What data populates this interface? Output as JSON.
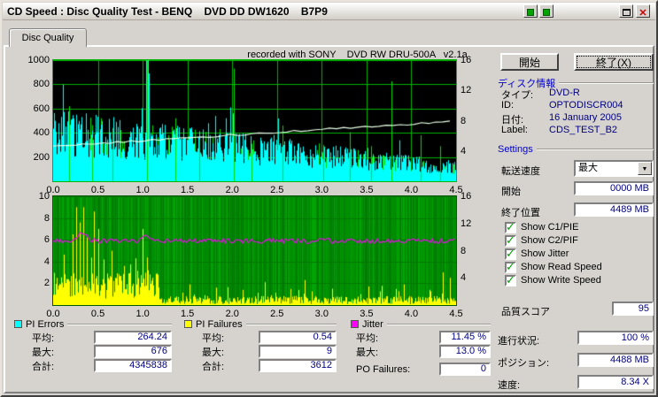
{
  "window": {
    "title": "CD Speed : Disc Quality Test - BENQ    DVD DD DW1620    B7P9"
  },
  "icons": {
    "close": "✕",
    "check": "✓",
    "combo_arrow": "▼"
  },
  "tab": {
    "label": "Disc Quality"
  },
  "recorder_note": "recorded with SONY    DVD RW DRU-500A   v2.1a",
  "actions": {
    "start": "開始",
    "exit": "終了(X)"
  },
  "disc_info": {
    "title": "ディスク情報",
    "rows": [
      {
        "label": "タイプ:",
        "value": "DVD-R"
      },
      {
        "label": "ID:",
        "value": "OPTODISCR004"
      },
      {
        "label": "日付:",
        "value": "16 January 2005"
      },
      {
        "label": "Label:",
        "value": "CDS_TEST_B2"
      }
    ]
  },
  "settings": {
    "title": "Settings",
    "transfer_speed_label": "転送速度",
    "transfer_speed_value": "最大",
    "start_label": "開始",
    "start_value": "0000 MB",
    "end_label": "終了位置",
    "end_value": "4489 MB",
    "checkboxes": [
      {
        "label": "Show C1/PIE",
        "checked": true
      },
      {
        "label": "Show C2/PIF",
        "checked": true
      },
      {
        "label": "Show Jitter",
        "checked": true
      },
      {
        "label": "Show Read Speed",
        "checked": true
      },
      {
        "label": "Show Write Speed",
        "checked": true
      }
    ],
    "quality_label": "品質スコア",
    "quality_value": "95"
  },
  "status": {
    "progress_label": "進行状況:",
    "progress_value": "100 %",
    "position_label": "ポジション:",
    "position_value": "4488 MB",
    "speed_label": "速度:",
    "speed_value": "8.34 X"
  },
  "stats": [
    {
      "title": "PI Errors",
      "swatch": "#00ffff",
      "rows": [
        {
          "label": "平均:",
          "value": "264.24"
        },
        {
          "label": "最大:",
          "value": "676"
        },
        {
          "label": "合計:",
          "value": "4345838"
        }
      ]
    },
    {
      "title": "PI Failures",
      "swatch": "#ffff00",
      "rows": [
        {
          "label": "平均:",
          "value": "0.54"
        },
        {
          "label": "最大:",
          "value": "9"
        },
        {
          "label": "合計:",
          "value": "3612"
        }
      ]
    },
    {
      "title": "Jitter",
      "swatch": "#ff00ff",
      "rows": [
        {
          "label": "平均:",
          "value": "11.45 %"
        },
        {
          "label": "最大:",
          "value": "13.0 %"
        },
        {
          "label": "PO Failures:",
          "value": "0"
        }
      ]
    }
  ],
  "chart_data": [
    {
      "type": "area",
      "name": "pi-errors-and-write-speed",
      "x_range": [
        0,
        4.5
      ],
      "x_ticks": [
        "0.0",
        "0.5",
        "1.0",
        "1.5",
        "2.0",
        "2.5",
        "3.0",
        "3.5",
        "4.0",
        "4.5"
      ],
      "y_left_range": [
        0,
        1000
      ],
      "y_left_ticks": [
        200,
        400,
        600,
        800,
        1000
      ],
      "y_right_range": [
        0,
        16
      ],
      "y_right_ticks": [
        4,
        8,
        12,
        16
      ],
      "bg": "#000000",
      "grid_color": "#00b400",
      "series": [
        {
          "name": "PIE",
          "color": "#00ffff",
          "style": "noisy-area",
          "trend_start": 412,
          "trend_end": 115,
          "spikes": [
            [
              0.31,
              470
            ],
            [
              1.04,
              1000
            ],
            [
              1.055,
              1000
            ],
            [
              1.07,
              890
            ],
            [
              1.98,
              610
            ],
            [
              2.01,
              560
            ]
          ]
        },
        {
          "name": "error-spikes",
          "color": "#00dc00",
          "style": "vlines",
          "points": [
            [
              0.18,
              620
            ],
            [
              0.44,
              360
            ],
            [
              0.66,
              440
            ],
            [
              1.045,
              1000
            ],
            [
              1.36,
              520
            ],
            [
              1.63,
              345
            ],
            [
              2.02,
              930
            ],
            [
              2.22,
              310
            ],
            [
              2.56,
              460
            ],
            [
              3.02,
              300
            ],
            [
              3.31,
              405
            ],
            [
              3.55,
              290
            ],
            [
              3.78,
              825
            ],
            [
              4.1,
              380
            ],
            [
              4.32,
              290
            ]
          ]
        },
        {
          "name": "write-speed",
          "color": "#e6ffe6",
          "style": "line",
          "start_value": 290,
          "end_value": 495
        }
      ]
    },
    {
      "type": "area",
      "name": "pi-failures-and-jitter",
      "x_range": [
        0,
        4.5
      ],
      "x_ticks": [
        "0.0",
        "0.5",
        "1.0",
        "1.5",
        "2.0",
        "2.5",
        "3.0",
        "3.5",
        "4.0",
        "4.5"
      ],
      "y_left_range": [
        0,
        10
      ],
      "y_left_ticks": [
        2,
        4,
        6,
        8,
        10
      ],
      "y_right_range": [
        0,
        16
      ],
      "y_right_ticks": [
        4,
        8,
        12,
        16
      ],
      "bg": "#00a404",
      "grid_color": "#007800",
      "series": [
        {
          "name": "PIF",
          "color": "#ffff00",
          "style": "noisy-bars",
          "dense_until": 1.18,
          "spikes": [
            [
              0.22,
              6.5
            ],
            [
              0.26,
              9
            ],
            [
              0.3,
              7.6
            ],
            [
              0.34,
              9
            ],
            [
              0.38,
              6.2
            ],
            [
              0.45,
              8.6
            ],
            [
              0.5,
              7
            ],
            [
              0.56,
              4.2
            ],
            [
              0.65,
              5
            ],
            [
              0.79,
              3.6
            ],
            [
              0.92,
              4.3
            ],
            [
              1.0,
              7
            ],
            [
              1.06,
              3.2
            ],
            [
              1.52,
              1.9
            ],
            [
              1.82,
              1.6
            ],
            [
              2.12,
              1.4
            ],
            [
              2.36,
              2.1
            ],
            [
              2.81,
              2.3
            ],
            [
              3.12,
              1.5
            ],
            [
              3.52,
              1.7
            ],
            [
              3.92,
              1.9
            ],
            [
              4.35,
              3
            ],
            [
              4.43,
              2.5
            ]
          ]
        },
        {
          "name": "jitter",
          "color": "#ff00ff",
          "style": "noisy-line",
          "level": 5.9
        },
        {
          "name": "surface-noise",
          "color": "#004600",
          "style": "vertical-noise"
        }
      ]
    }
  ]
}
